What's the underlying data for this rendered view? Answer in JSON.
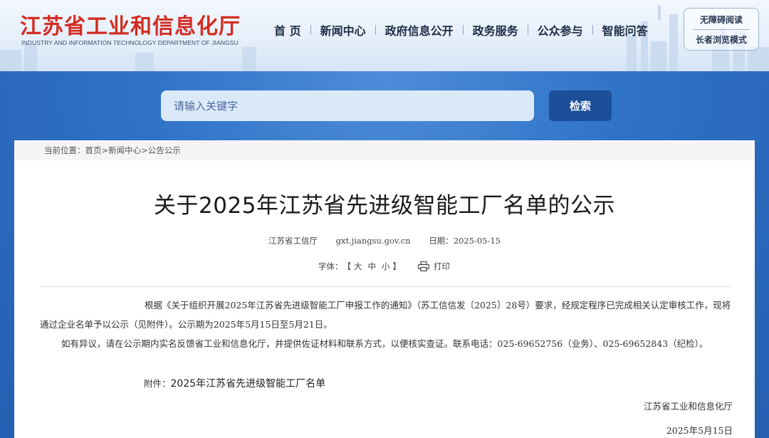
{
  "header": {
    "logo_cn": "江苏省工业和信息化厅",
    "logo_en": "INDUSTRY AND INFORMATION TECHNOLOGY DEPARTMENT OF JIANGSU",
    "nav": [
      "首 页",
      "新闻中心",
      "政府信息公开",
      "政务服务",
      "公众参与",
      "智能问答"
    ],
    "accessibility": {
      "barrier_free": "无障碍阅读",
      "elder_mode": "长者浏览模式"
    }
  },
  "search": {
    "placeholder": "请输入关键字",
    "button": "检索"
  },
  "breadcrumb": {
    "prefix": "当前位置：",
    "items": [
      "首页",
      "新闻中心",
      "公告公示"
    ],
    "separator": ">"
  },
  "article": {
    "title": "关于2025年江苏省先进级智能工厂名单的公示",
    "source": "江苏省工信厅",
    "site": "gxt.jiangsu.gov.cn",
    "date_label": "日期：",
    "date": "2025-05-15",
    "font_label": "字体：",
    "font_open": "【",
    "font_sizes": [
      "大",
      "中",
      "小"
    ],
    "font_close": "】",
    "print": "打印",
    "paragraph1": "根据《关于组织开展2025年江苏省先进级智能工厂申报工作的通知》（苏工信信发〔2025〕28号）要求，经规定程序已完成相关认定审核工作，现将通过企业名单予以公示（见附件）。公示期为2025年5月15日至5月21日。",
    "paragraph2": "如有异议，请在公示期内实名反馈省工业和信息化厅，并提供佐证材料和联系方式，以便核实查证。联系电话：025-69652756（业务）、025-69652843（纪检）。",
    "attachment_label": "附件：",
    "attachment_name": "2025年江苏省先进级智能工厂名单",
    "signature_org": "江苏省工业和信息化厅",
    "signature_date": "2025年5月15日"
  },
  "colors": {
    "logo_red": "#d42c22",
    "banner_blue": "#2f72c6",
    "search_button": "#1b4f9a"
  }
}
